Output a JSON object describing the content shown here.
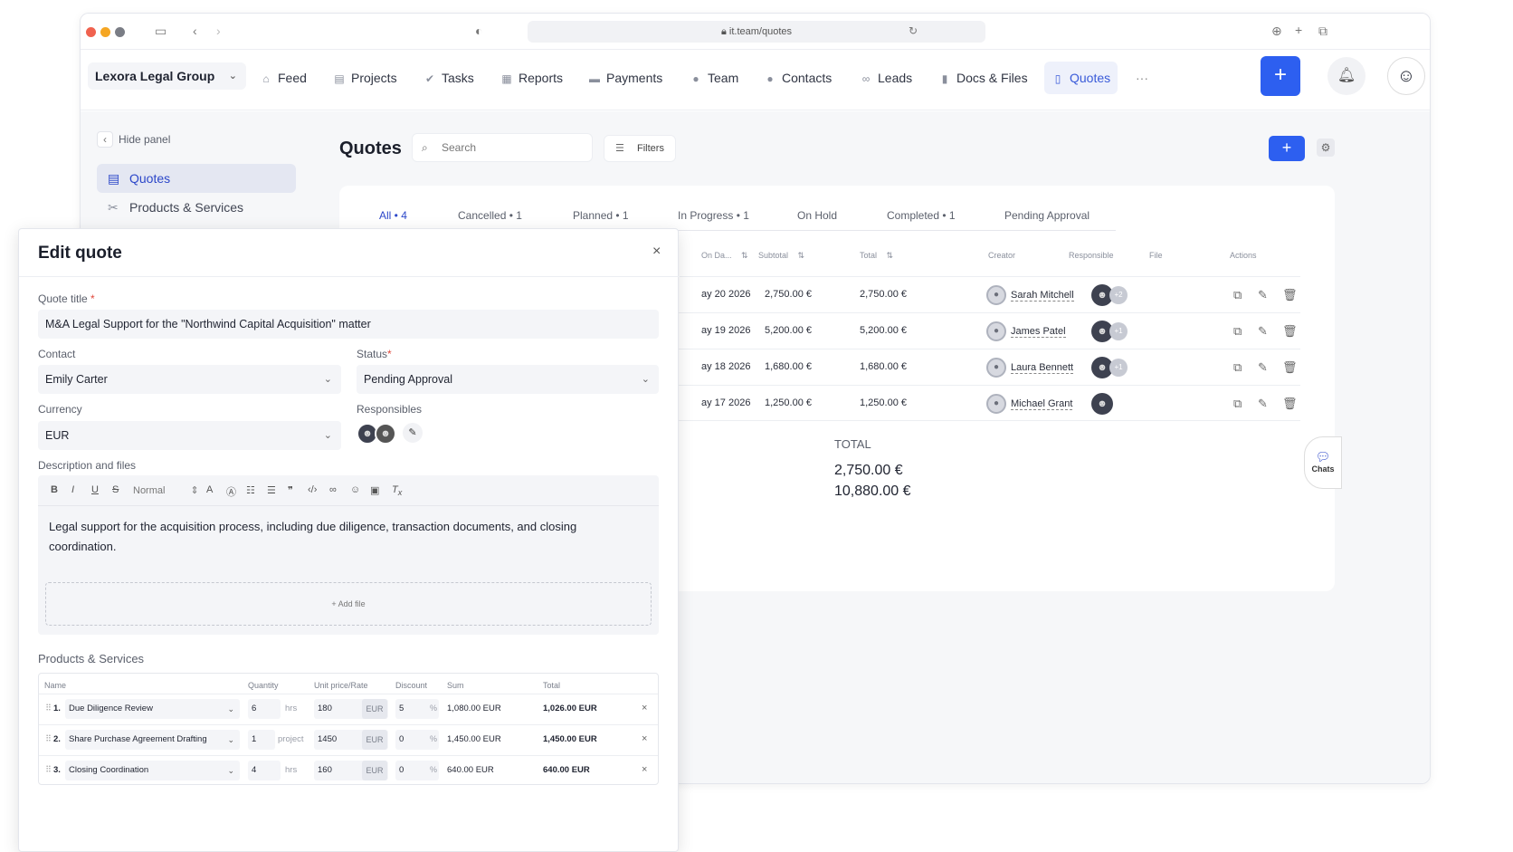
{
  "browser": {
    "url": "it.team/quotes"
  },
  "nav": {
    "workspace": "Lexora Legal Group",
    "items": [
      {
        "label": "Feed",
        "icon": "home-icon"
      },
      {
        "label": "Projects",
        "icon": "folder-icon"
      },
      {
        "label": "Tasks",
        "icon": "check-circle-icon"
      },
      {
        "label": "Reports",
        "icon": "report-icon"
      },
      {
        "label": "Payments",
        "icon": "card-icon"
      },
      {
        "label": "Team",
        "icon": "person-icon"
      },
      {
        "label": "Contacts",
        "icon": "people-icon"
      },
      {
        "label": "Leads",
        "icon": "link-icon"
      },
      {
        "label": "Docs & Files",
        "icon": "book-icon"
      },
      {
        "label": "Quotes",
        "icon": "document-icon",
        "active": true
      }
    ],
    "more": "···",
    "plus": "+"
  },
  "sidebar": {
    "hide_panel": "Hide panel",
    "items": [
      {
        "label": "Quotes",
        "active": true
      },
      {
        "label": "Products & Services"
      }
    ]
  },
  "quotes_page": {
    "title": "Quotes",
    "search_placeholder": "Search",
    "filters": "Filters",
    "add": "+",
    "tabs": [
      "All • 4",
      "Cancelled • 1",
      "Planned • 1",
      "In Progress • 1",
      "On Hold",
      "Completed • 1",
      "Pending Approval"
    ],
    "columns": [
      "On Da...",
      "Subtotal",
      "Total",
      "Creator",
      "Responsible",
      "File",
      "Actions"
    ],
    "rows": [
      {
        "date": "ay 20 2026",
        "subtotal": "2,750.00 €",
        "total": "2,750.00 €",
        "creator": "Sarah Mitchell",
        "extra": "+2"
      },
      {
        "date": "ay 19 2026",
        "subtotal": "5,200.00 €",
        "total": "5,200.00 €",
        "creator": "James Patel",
        "extra": "+1"
      },
      {
        "date": "ay 18 2026",
        "subtotal": "1,680.00 €",
        "total": "1,680.00 €",
        "creator": "Laura Bennett",
        "extra": "+1"
      },
      {
        "date": "ay 17 2026",
        "subtotal": "1,250.00 €",
        "total": "1,250.00 €",
        "creator": "Michael Grant",
        "extra": ""
      }
    ],
    "total_label": "TOTAL",
    "total_1": "2,750.00 €",
    "total_2": "10,880.00 €",
    "chats": "Chats"
  },
  "edit_quote": {
    "title": "Edit quote",
    "close": "×",
    "quote_title_label": "Quote title",
    "quote_title_value": "M&A Legal Support for the \"Northwind Capital Acquisition\" matter",
    "contact_label": "Contact",
    "contact_value": "Emily Carter",
    "status_label": "Status",
    "status_value": "Pending Approval",
    "currency_label": "Currency",
    "currency_value": "EUR",
    "responsibles_label": "Responsibles",
    "description_label": "Description and files",
    "format_value": "Normal",
    "description": "Legal support for the acquisition process, including due diligence, transaction documents, and closing coordination.",
    "add_file": "+ Add file",
    "products_title": "Products & Services",
    "product_columns": [
      "Name",
      "Quantity",
      "Unit price/Rate",
      "Discount",
      "Sum",
      "Total"
    ],
    "products": [
      {
        "num": "1.",
        "name": "Due Diligence Review",
        "qty": "6",
        "unit": "hrs",
        "price": "180",
        "cur": "EUR",
        "discount": "5",
        "sum": "1,080.00 EUR",
        "total": "1,026.00 EUR"
      },
      {
        "num": "2.",
        "name": "Share Purchase Agreement Drafting",
        "qty": "1",
        "unit": "project",
        "price": "1450",
        "cur": "EUR",
        "discount": "0",
        "sum": "1,450.00 EUR",
        "total": "1,450.00 EUR"
      },
      {
        "num": "3.",
        "name": "Closing Coordination",
        "qty": "4",
        "unit": "hrs",
        "price": "160",
        "cur": "EUR",
        "discount": "0",
        "sum": "640.00 EUR",
        "total": "640.00 EUR"
      }
    ]
  },
  "colors": {
    "accent": "#2d5ff0",
    "active_nav_bg": "#eef1fb",
    "required": "#e0483c"
  }
}
